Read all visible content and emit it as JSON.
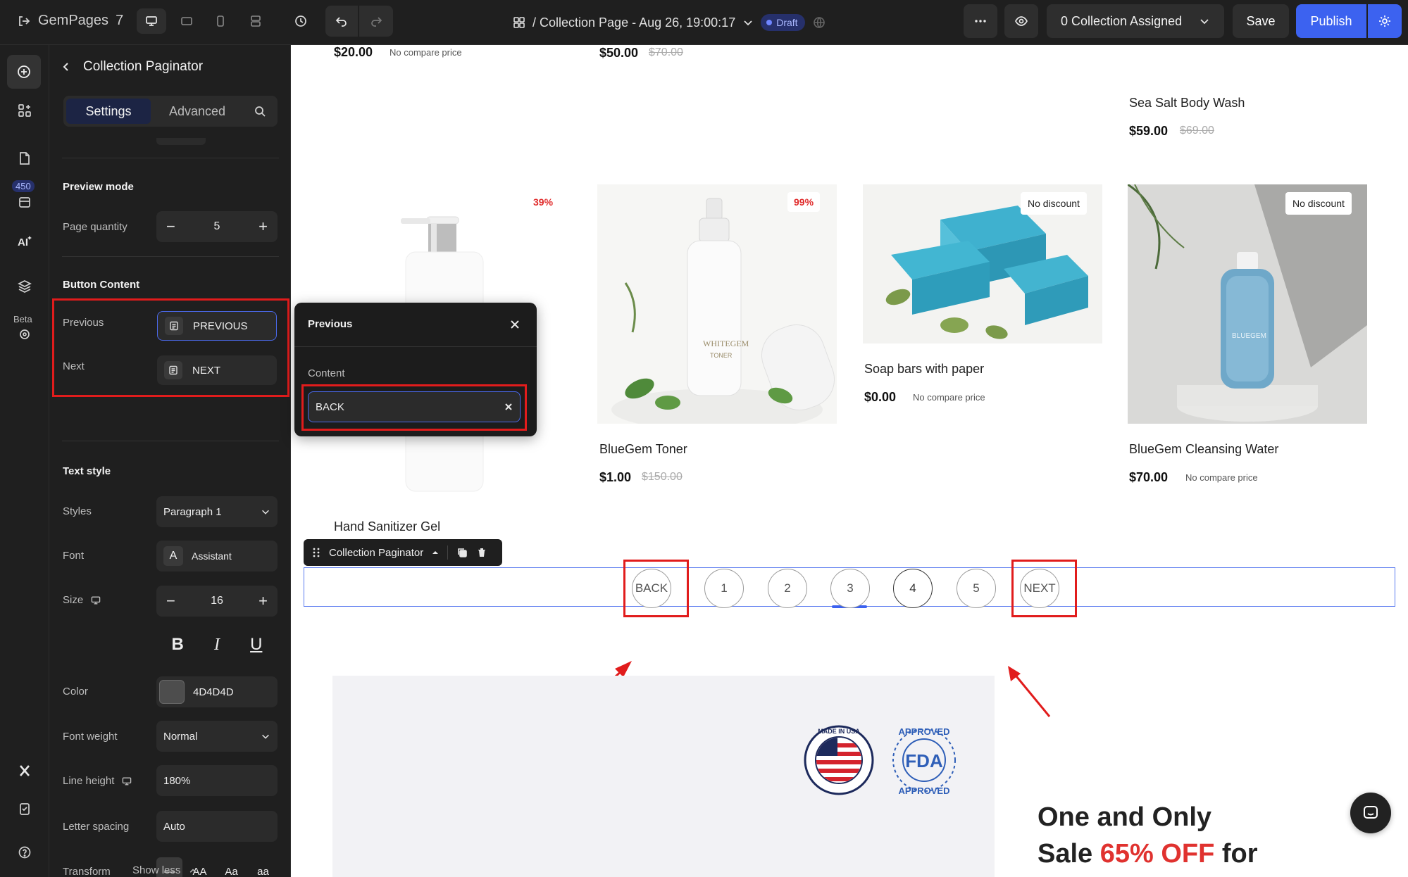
{
  "topbar": {
    "brand": "GemPages",
    "version": "7",
    "page_title": "/ Collection Page - Aug 26, 19:00:17",
    "status": "Draft",
    "assign_label": "0 Collection Assigned",
    "save_label": "Save",
    "publish_label": "Publish"
  },
  "rail": {
    "badge": "450",
    "beta": "Beta"
  },
  "panel": {
    "title": "Collection Paginator",
    "tabs": [
      "Settings",
      "Advanced"
    ],
    "preview_mode": "Preview mode",
    "page_quantity_label": "Page quantity",
    "page_quantity": "5",
    "button_content": "Button Content",
    "previous_label": "Previous",
    "previous_value": "PREVIOUS",
    "next_label": "Next",
    "next_value": "NEXT",
    "text_style": "Text style",
    "styles_label": "Styles",
    "styles_value": "Paragraph 1",
    "font_label": "Font",
    "font_value": "Assistant",
    "size_label": "Size",
    "size_value": "16",
    "color_label": "Color",
    "color_value": "4D4D4D",
    "color_hex": "#4d4d4d",
    "font_weight_label": "Font weight",
    "font_weight_value": "Normal",
    "line_height_label": "Line height",
    "line_height_value": "180%",
    "letter_spacing_label": "Letter spacing",
    "letter_spacing_value": "Auto",
    "transform_label": "Transform",
    "transform_options": [
      "—",
      "AA",
      "Aa",
      "aa"
    ],
    "show_less": "Show less"
  },
  "popover": {
    "title": "Previous",
    "content_label": "Content",
    "content_value": "BACK"
  },
  "canvas": {
    "products_top": [
      {
        "price": "$20.00",
        "compare": "No compare price"
      },
      {
        "price": "$50.00",
        "compare": "$70.00"
      }
    ],
    "sea_salt": {
      "title": "Sea Salt Body Wash",
      "price": "$59.00",
      "compare": "$69.00"
    },
    "products": [
      {
        "badge": "39%",
        "title": "Hand Sanitizer Gel"
      },
      {
        "badge": "99%",
        "title": "BlueGem Toner",
        "price": "$1.00",
        "compare": "$150.00"
      },
      {
        "badge": "No discount",
        "title": "Soap bars with paper",
        "price": "$0.00",
        "compare": "No compare price"
      },
      {
        "badge": "No discount",
        "title": "BlueGem Cleansing Water",
        "price": "$70.00",
        "compare": "No compare price"
      }
    ],
    "paginator_toolbar": "Collection Paginator",
    "pagination": [
      "BACK",
      "1",
      "2",
      "3",
      "4",
      "5",
      "NEXT"
    ],
    "promo_line1": "One and Only",
    "promo_sale": "Sale ",
    "promo_off": "65% OFF",
    "promo_for": " for",
    "badge_usa": "MADE IN USA",
    "badge_fda_top": "APPROVED",
    "badge_fda_mid": "FDA",
    "badge_fda_bottom": "APPROVED"
  }
}
